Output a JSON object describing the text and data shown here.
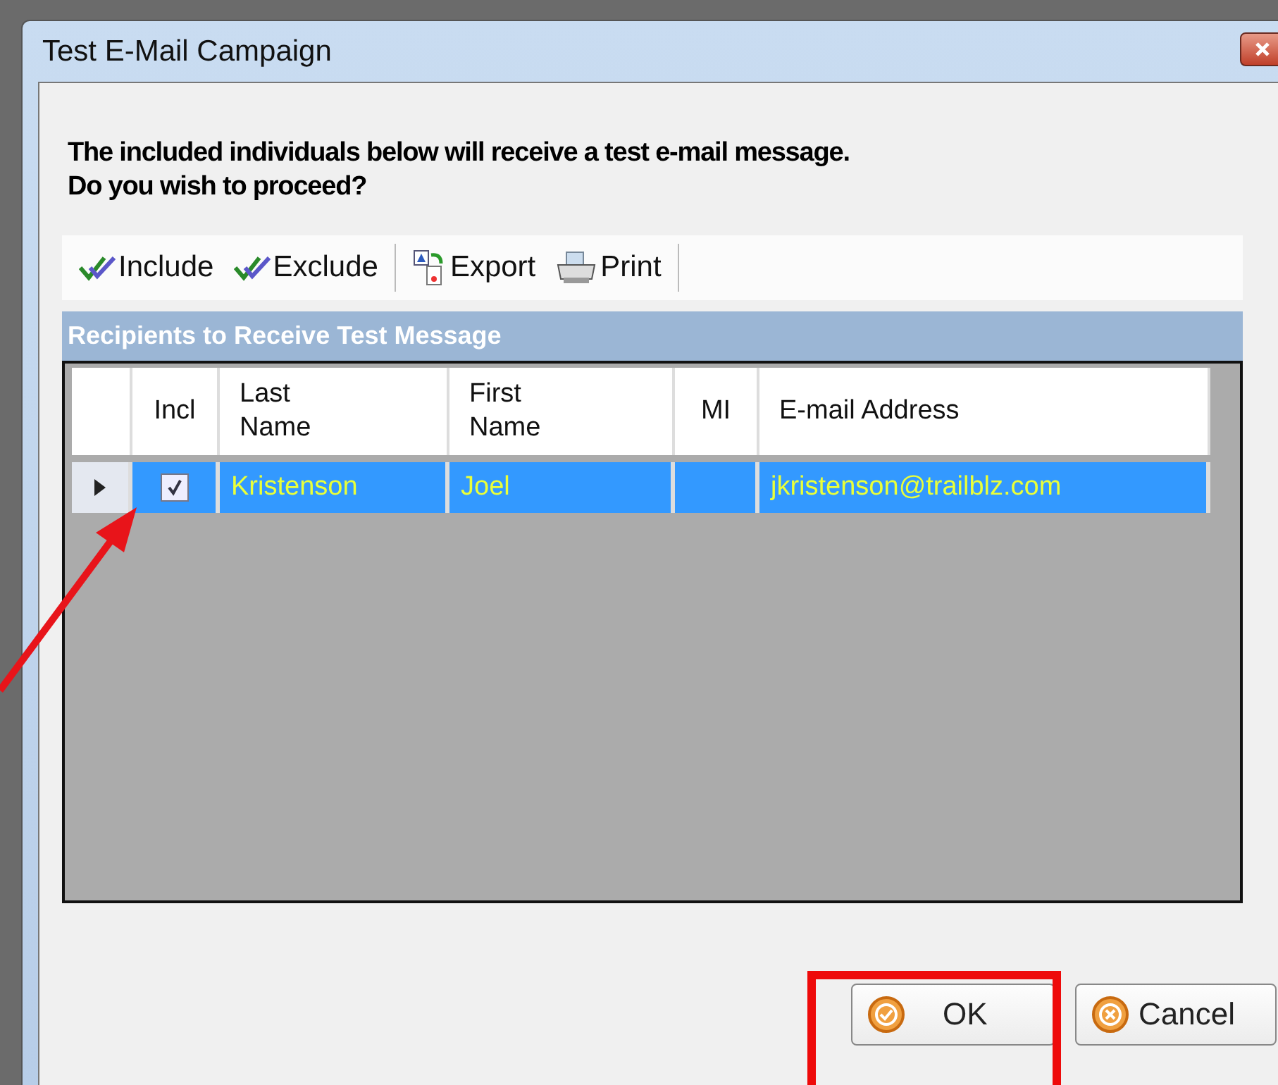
{
  "window": {
    "title": "Test E-Mail Campaign"
  },
  "message": [
    "The included individuals below will receive a test e-mail message.",
    "Do you wish to proceed?"
  ],
  "toolbar": [
    {
      "kind": "check",
      "label": "Include"
    },
    {
      "kind": "check",
      "label": "Exclude"
    },
    {
      "kind": "export",
      "label": "Export"
    },
    {
      "kind": "print",
      "label": "Print"
    }
  ],
  "grid": {
    "title": "Recipients to Receive Test Message",
    "columns": [
      "Incl",
      "Last Name",
      "First Name",
      "MI",
      "E-mail Address"
    ],
    "rows": [
      {
        "current": true,
        "selected": true,
        "checked": true,
        "last_name": "Kristenson",
        "first_name": "Joel",
        "mi": "",
        "email": "jkristenson@trailblz.com"
      }
    ]
  },
  "buttons": [
    {
      "kind": "ok",
      "label": "OK"
    },
    {
      "kind": "cancel",
      "label": "Cancel"
    }
  ]
}
